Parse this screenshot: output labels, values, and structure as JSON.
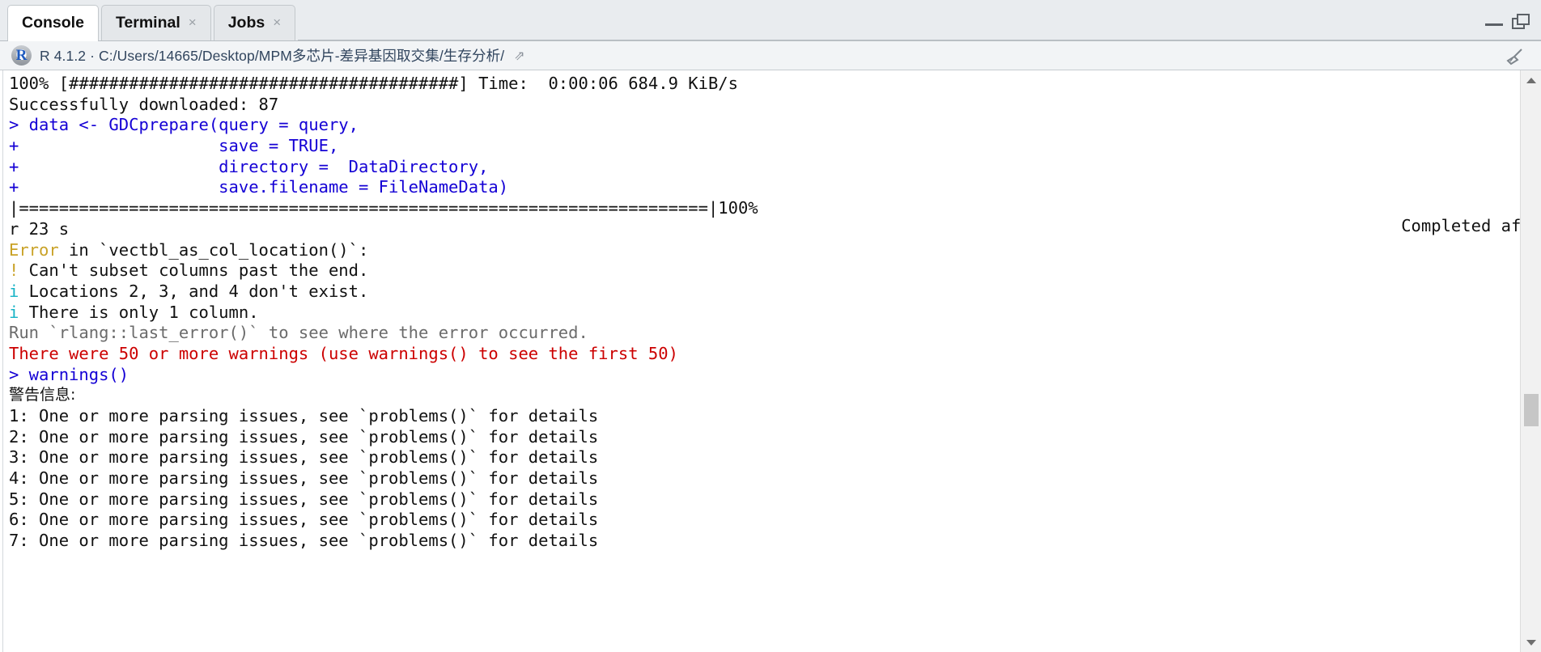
{
  "window": {
    "controls": [
      {
        "name": "minimize",
        "label": "—"
      },
      {
        "name": "maximize-restore",
        "label": "❐"
      }
    ]
  },
  "tabs": [
    {
      "label": "Console",
      "active": true,
      "closable": false,
      "close_label": ""
    },
    {
      "label": "Terminal",
      "active": false,
      "closable": true,
      "close_label": "×"
    },
    {
      "label": "Jobs",
      "active": false,
      "closable": true,
      "close_label": "×"
    }
  ],
  "pathbar": {
    "r_logo_letter": "R",
    "version": "R 4.1.2",
    "separator": "·",
    "working_directory": "C:/Users/14665/Desktop/MPM多芯片-差异基因取交集/生存分析/",
    "full_line": "R 4.1.2  ·  C:/Users/14665/Desktop/MPM多芯片-差异基因取交集/生存分析/",
    "shortcut_arrow": "⇗",
    "broom_icon": "broom-icon"
  },
  "console": {
    "lines": [
      {
        "id": "l01",
        "color": "black",
        "text": "100% [#######################################] Time:  0:00:06 684.9 KiB/s"
      },
      {
        "id": "l02",
        "color": "black",
        "text": "Successfully downloaded: 87"
      },
      {
        "id": "l03",
        "color": "blue",
        "text": "> data <- GDCprepare(query = query,"
      },
      {
        "id": "l04",
        "color": "blue",
        "text": "+                    save = TRUE,"
      },
      {
        "id": "l05",
        "color": "blue",
        "text": "+                    directory =  DataDirectory,"
      },
      {
        "id": "l06",
        "color": "blue",
        "text": "+                    save.filename = FileNameData)"
      },
      {
        "id": "l07",
        "color": "black",
        "text": "|=====================================================================|100%"
      },
      {
        "id": "l07b",
        "color": "black",
        "text": "Completed afte",
        "right_overflow": true
      },
      {
        "id": "l08",
        "color": "black",
        "text": "r 23 s"
      },
      {
        "id": "l09",
        "color": "gold-prefix",
        "prefix": "Error",
        "text": " in `vectbl_as_col_location()`:"
      },
      {
        "id": "l10",
        "color": "gold-bullet",
        "prefix": "!",
        "text": " Can't subset columns past the end."
      },
      {
        "id": "l11",
        "color": "teal-bullet",
        "prefix": "i",
        "text": " Locations 2, 3, and 4 don't exist."
      },
      {
        "id": "l12",
        "color": "teal-bullet",
        "prefix": "i",
        "text": " There is only 1 column."
      },
      {
        "id": "l13",
        "color": "gray",
        "text": "Run `rlang::last_error()` to see where the error occurred."
      },
      {
        "id": "l14",
        "color": "red",
        "text": "There were 50 or more warnings (use warnings() to see the first 50)"
      },
      {
        "id": "l15",
        "color": "blue",
        "text": "> warnings()"
      },
      {
        "id": "l16",
        "color": "black",
        "cjk": true,
        "text": "警告信息:"
      },
      {
        "id": "l17",
        "color": "black",
        "text": "1: One or more parsing issues, see `problems()` for details"
      },
      {
        "id": "l18",
        "color": "black",
        "text": "2: One or more parsing issues, see `problems()` for details"
      },
      {
        "id": "l19",
        "color": "black",
        "text": "3: One or more parsing issues, see `problems()` for details"
      },
      {
        "id": "l20",
        "color": "black",
        "text": "4: One or more parsing issues, see `problems()` for details"
      },
      {
        "id": "l21",
        "color": "black",
        "text": "5: One or more parsing issues, see `problems()` for details"
      },
      {
        "id": "l22",
        "color": "black",
        "text": "6: One or more parsing issues, see `problems()` for details"
      },
      {
        "id": "l23",
        "color": "black",
        "text": "7: One or more parsing issues, see `problems()` for details"
      }
    ]
  },
  "scrollbar": {
    "up_arrow": "▲",
    "down_arrow": "▼",
    "thumb_name": "scrollbar-thumb"
  },
  "colors": {
    "prompt_blue": "#1400d5",
    "error_red": "#cc0000",
    "warning_gold": "#c9a227",
    "info_teal": "#17b3c6",
    "muted_gray": "#6b6b6b",
    "tab_active_bg": "#ffffff",
    "tabstrip_bg": "#e9ecef",
    "pathbar_bg": "#f2f4f6"
  }
}
